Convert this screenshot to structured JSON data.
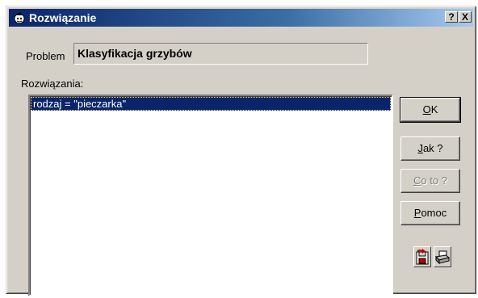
{
  "window": {
    "title": "Rozwiązanie",
    "help_button": "?",
    "close_button": "X"
  },
  "problem": {
    "label": "Problem",
    "value": "Klasyfikacja grzybów"
  },
  "solutions": {
    "label": "Rozwiązania:",
    "items": [
      "rodzaj = \"pieczarka\""
    ],
    "selected_index": 0
  },
  "buttons": {
    "ok": {
      "mnemonic": "O",
      "rest": "K"
    },
    "how": {
      "mnemonic": "J",
      "rest": "ak ?"
    },
    "what": {
      "mnemonic": "C",
      "rest": "o to ?",
      "disabled": true
    },
    "help": {
      "mnemonic": "P",
      "rest": "omoc"
    }
  },
  "icons": {
    "title": "app-icon",
    "save": "save-icon",
    "print": "print-icon"
  },
  "colors": {
    "title_bar": "#0a246a",
    "selection": "#0a246a",
    "face": "#d4d0c8"
  }
}
